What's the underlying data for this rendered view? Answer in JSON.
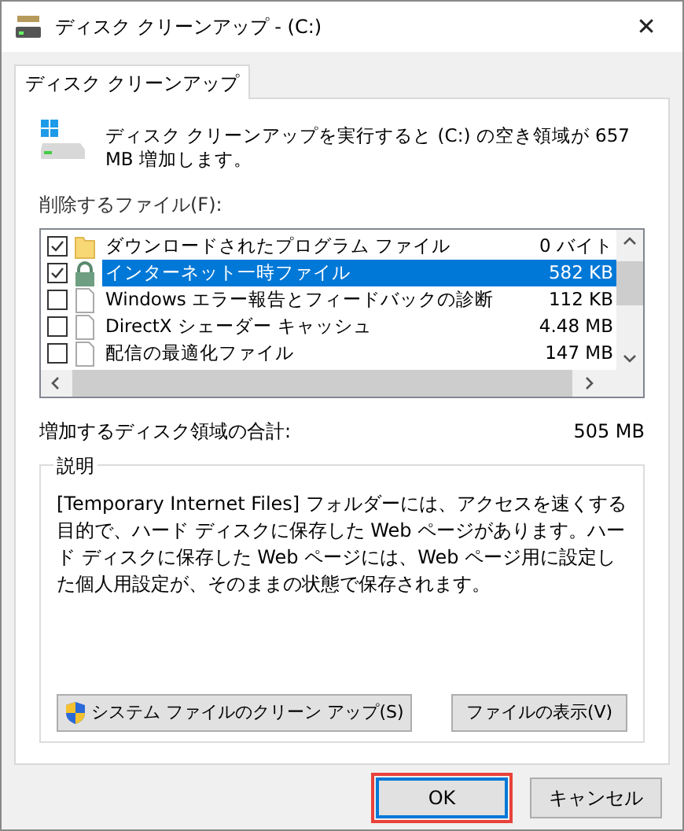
{
  "window": {
    "title": "ディスク クリーンアップ - (C:)",
    "close": "✕"
  },
  "tabs": [
    {
      "label": "ディスク クリーンアップ",
      "selected": true
    }
  ],
  "summary": "ディスク クリーンアップを実行すると (C:) の空き領域が 657 MB 増加します。",
  "files_label": "削除するファイル(F):",
  "files": [
    {
      "name": "ダウンロードされたプログラム ファイル",
      "size": "0 バイト",
      "checked": true,
      "selected": false,
      "kind": "folder"
    },
    {
      "name": "インターネット一時ファイル",
      "size": "582 KB",
      "checked": true,
      "selected": true,
      "kind": "lock"
    },
    {
      "name": "Windows エラー報告とフィードバックの診断",
      "size": "112 KB",
      "checked": false,
      "selected": false,
      "kind": "file"
    },
    {
      "name": "DirectX シェーダー キャッシュ",
      "size": "4.48 MB",
      "checked": false,
      "selected": false,
      "kind": "file"
    },
    {
      "name": "配信の最適化ファイル",
      "size": "147 MB",
      "checked": false,
      "selected": false,
      "kind": "file"
    }
  ],
  "total": {
    "label": "増加するディスク領域の合計:",
    "value": "505 MB"
  },
  "description": {
    "title": "説明",
    "text": "[Temporary Internet Files] フォルダーには、アクセスを速くする目的で、ハード ディスクに保存した Web ページがあります。ハード ディスクに保存した Web ページには、Web ページ用に設定した個人用設定が、そのままの状態で保存されます。"
  },
  "panel_buttons": [
    {
      "label": "システム ファイルのクリーン アップ(S)",
      "kind": "shield"
    },
    {
      "label": "ファイルの表示(V)",
      "kind": "plain"
    }
  ],
  "buttons": [
    {
      "label": "OK",
      "default": true,
      "highlighted": true
    },
    {
      "label": "キャンセル",
      "default": false,
      "highlighted": false
    }
  ]
}
